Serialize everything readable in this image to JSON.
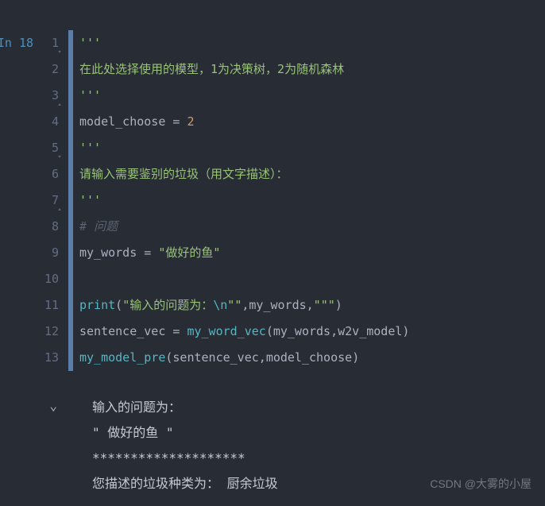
{
  "prompt": {
    "label": "In",
    "count": "18"
  },
  "gutter_lines": [
    "1",
    "2",
    "3",
    "4",
    "5",
    "6",
    "7",
    "8",
    "9",
    "10",
    "11",
    "12",
    "13"
  ],
  "code": {
    "l1": "'''",
    "l2": "在此处选择使用的模型，1为决策树，2为随机森林",
    "l3": "'''",
    "l4_var": "model_choose",
    "l4_op": " = ",
    "l4_num": "2",
    "l5": "'''",
    "l6": "请输入需要鉴别的垃圾（用文字描述）：",
    "l7": "'''",
    "l8_hash": "# ",
    "l8_text": "问题",
    "l9_var": "my_words",
    "l9_op": " = ",
    "l9_str": "\"做好的鱼\"",
    "l11_func": "print",
    "l11_p1": "(",
    "l11_str1": "\"输入的问题为：",
    "l11_esc": "\\n",
    "l11_str1end": "\"\"",
    "l11_c1": ",",
    "l11_arg": "my_words",
    "l11_c2": ",",
    "l11_str2": "\"\"\"",
    "l11_p2": ")",
    "l12_var": "sentence_vec",
    "l12_op": " = ",
    "l12_func": "my_word_vec",
    "l12_p1": "(",
    "l12_a1": "my_words",
    "l12_c1": ",",
    "l12_a2": "w2v_model",
    "l12_p2": ")",
    "l13_func": "my_model_pre",
    "l13_p1": "(",
    "l13_a1": "sentence_vec",
    "l13_c1": ",",
    "l13_a2": "model_choose",
    "l13_p2": ")"
  },
  "output": {
    "line1": "输入的问题为：",
    "line2": "\" 做好的鱼 \"",
    "line3": "********************",
    "line4": "您描述的垃圾种类为：  厨余垃圾"
  },
  "watermark": "CSDN @大雾的小屋"
}
